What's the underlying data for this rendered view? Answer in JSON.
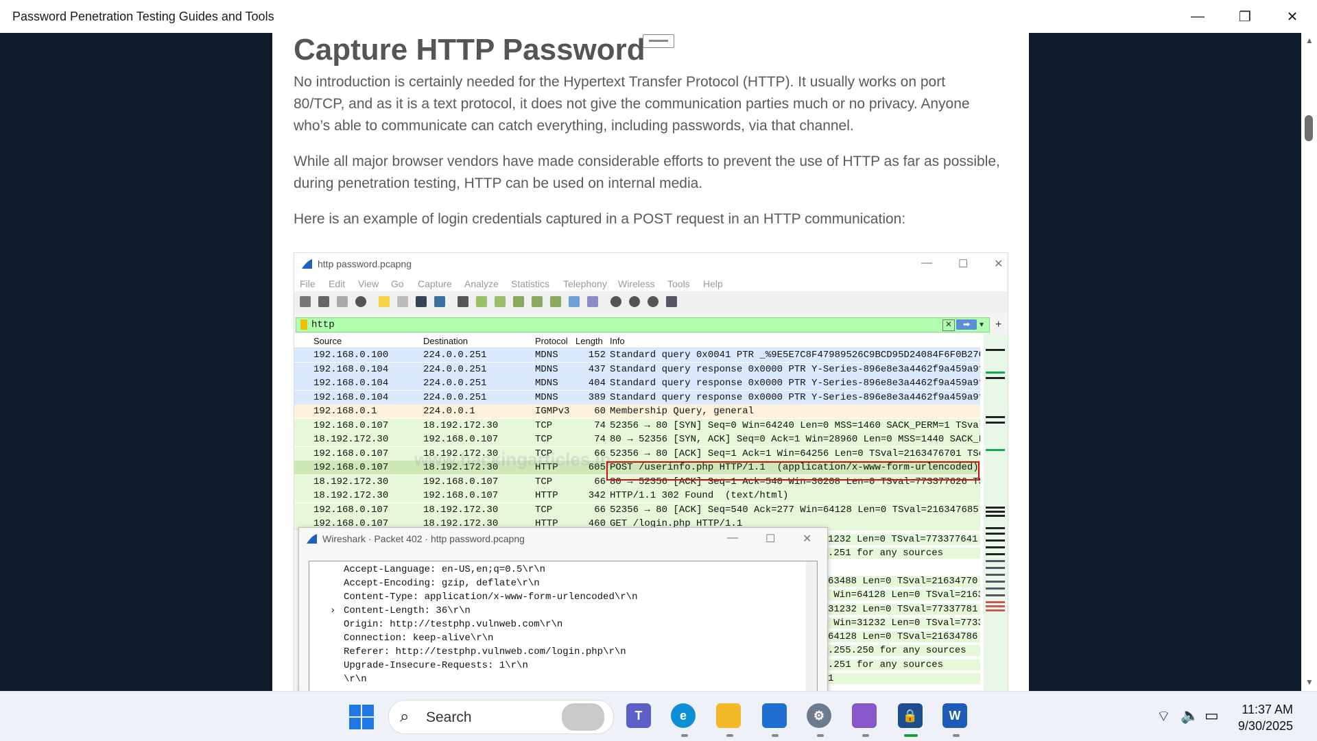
{
  "window": {
    "title": "Password Penetration Testing Guides and Tools",
    "minimize": "—",
    "restore": "❐",
    "close": "✕"
  },
  "article": {
    "heading": "Capture HTTP Password",
    "paragraphs": [
      "No introduction is certainly needed for the Hypertext Transfer Protocol (HTTP). It usually works on port 80/TCP, and as it is a text protocol, it does not give the communication parties much or no privacy. Anyone who’s able to communicate can catch everything, including passwords, via that channel.",
      "While all major browser vendors have made considerable efforts to prevent the use of HTTP as far as possible, during penetration testing, HTTP can be used on internal media.",
      "Here is an example of login credentials captured in a POST request in an HTTP communication:"
    ]
  },
  "wireshark": {
    "title": "http password.pcapng",
    "menu": [
      "File",
      "Edit",
      "View",
      "Go",
      "Capture",
      "Analyze",
      "Statistics",
      "Telephony",
      "Wireless",
      "Tools",
      "Help"
    ],
    "filter": "http",
    "watermark": "www.hackingarticles.in",
    "columns": [
      "Source",
      "Destination",
      "Protocol",
      "Length",
      "Info"
    ],
    "rows": [
      {
        "src": "192.168.0.100",
        "dst": "224.0.0.251",
        "proto": "MDNS",
        "len": "152",
        "info": "Standard query 0x0041 PTR _%9E5E7C8F47989526C9BCD95D24084F6F0B27C",
        "color": "#dbe9ff"
      },
      {
        "src": "192.168.0.104",
        "dst": "224.0.0.251",
        "proto": "MDNS",
        "len": "437",
        "info": "Standard query response 0x0000 PTR Y-Series-896e8e3a4462f9a459a9f",
        "color": "#dbe9ff"
      },
      {
        "src": "192.168.0.104",
        "dst": "224.0.0.251",
        "proto": "MDNS",
        "len": "404",
        "info": "Standard query response 0x0000 PTR Y-Series-896e8e3a4462f9a459a9f",
        "color": "#dbe9ff"
      },
      {
        "src": "192.168.0.104",
        "dst": "224.0.0.251",
        "proto": "MDNS",
        "len": "389",
        "info": "Standard query response 0x0000 PTR Y-Series-896e8e3a4462f9a459a9f",
        "color": "#dbe9ff"
      },
      {
        "src": "192.168.0.1",
        "dst": "224.0.0.1",
        "proto": "IGMPv3",
        "len": "60",
        "info": "Membership Query, general",
        "color": "#fdf2dc"
      },
      {
        "src": "192.168.0.107",
        "dst": "18.192.172.30",
        "proto": "TCP",
        "len": "74",
        "info": "52356 → 80 [SYN] Seq=0 Win=64240 Len=0 MSS=1460 SACK_PERM=1 TSval",
        "color": "#e6f8d8"
      },
      {
        "src": "18.192.172.30",
        "dst": "192.168.0.107",
        "proto": "TCP",
        "len": "74",
        "info": "80 → 52356 [SYN, ACK] Seq=0 Ack=1 Win=28960 Len=0 MSS=1440 SACK_F",
        "color": "#e6f8d8"
      },
      {
        "src": "192.168.0.107",
        "dst": "18.192.172.30",
        "proto": "TCP",
        "len": "66",
        "info": "52356 → 80 [ACK] Seq=1 Ack=1 Win=64256 Len=0 TSval=2163476701 TSe",
        "color": "#e6f8d8"
      },
      {
        "src": "192.168.0.107",
        "dst": "18.192.172.30",
        "proto": "HTTP",
        "len": "605",
        "info": "POST /userinfo.php HTTP/1.1  (application/x-www-form-urlencoded)",
        "color": "#cfe8b8"
      },
      {
        "src": "18.192.172.30",
        "dst": "192.168.0.107",
        "proto": "TCP",
        "len": "66",
        "info": "80 → 52356 [ACK] Seq=1 Ack=540 Win=30208 Len=0 TSval=773377626 TS",
        "color": "#e6f8d8"
      },
      {
        "src": "18.192.172.30",
        "dst": "192.168.0.107",
        "proto": "HTTP",
        "len": "342",
        "info": "HTTP/1.1 302 Found  (text/html)",
        "color": "#e6f8d8"
      },
      {
        "src": "192.168.0.107",
        "dst": "18.192.172.30",
        "proto": "TCP",
        "len": "66",
        "info": "52356 → 80 [ACK] Seq=540 Ack=277 Win=64128 Len=0 TSval=216347685",
        "color": "#e6f8d8"
      },
      {
        "src": "192.168.0.107",
        "dst": "18.192.172.30",
        "proto": "HTTP",
        "len": "460",
        "info": "GET /login.php HTTP/1.1",
        "color": "#e6f8d8"
      }
    ],
    "behind_text": [
      "1232 Len=0 TSval=773377641",
      ".251 for any sources",
      "",
      "63488 Len=0 TSval=21634770",
      " Win=64128 Len=0 TSval=2163",
      "31232 Len=0 TSval=77337781",
      " Win=31232 Len=0 TSval=7733",
      "64128 Len=0 TSval=21634786",
      ".255.250 for any sources",
      ".251 for any sources",
      "1"
    ]
  },
  "packet_window": {
    "title": "Wireshark · Packet 402 · http password.pcapng",
    "lines": [
      "Accept-Language: en-US,en;q=0.5\\r\\n",
      "Accept-Encoding: gzip, deflate\\r\\n",
      "Content-Type: application/x-www-form-urlencoded\\r\\n",
      "Content-Length: 36\\r\\n",
      "Origin: http://testphp.vulnweb.com\\r\\n",
      "Connection: keep-alive\\r\\n",
      "Referer: http://testphp.vulnweb.com/login.php\\r\\n",
      "Upgrade-Insecure-Requests: 1\\r\\n",
      "\\r\\n"
    ]
  },
  "taskbar": {
    "search_placeholder": "Search",
    "time": "11:37 AM",
    "date": "9/30/2025"
  }
}
